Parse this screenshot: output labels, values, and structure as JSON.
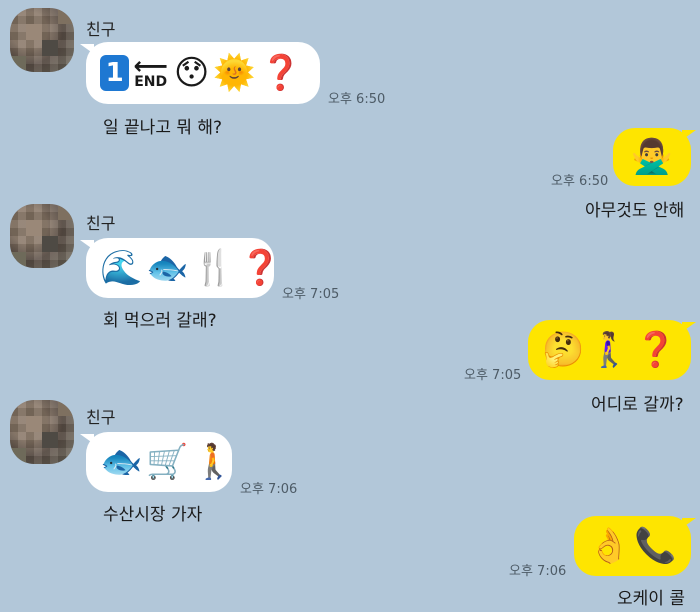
{
  "contact_name": "친구",
  "messages": [
    {
      "sender": "friend",
      "emoji": [
        "keycap-1",
        "end-arrow",
        "😯",
        "🌞",
        "❓"
      ],
      "text": "일 끝나고 뭐 해?",
      "time": "오후 6:50"
    },
    {
      "sender": "me",
      "emoji": [
        "🙅‍♂️"
      ],
      "text": "아무것도 안해",
      "time": "오후 6:50"
    },
    {
      "sender": "friend",
      "emoji": [
        "🌊",
        "🐟",
        "🍴",
        "❓"
      ],
      "text": "회 먹으러 갈래?",
      "time": "오후 7:05"
    },
    {
      "sender": "me",
      "emoji": [
        "🤔",
        "🚶‍♀️",
        "❓"
      ],
      "text": "어디로 갈까?",
      "time": "오후 7:05"
    },
    {
      "sender": "friend",
      "emoji": [
        "🐟",
        "🛒",
        "🚶"
      ],
      "text": "수산시장 가자",
      "time": "오후 7:06"
    },
    {
      "sender": "me",
      "emoji": [
        "👌",
        "📞"
      ],
      "text": "오케이 콜",
      "time": "오후 7:06"
    }
  ],
  "icons": {
    "keycap": "1",
    "end_label": "END",
    "end_arrow": "⟵"
  },
  "colors": {
    "background": "#b2c7d9",
    "friend_bubble": "#ffffff",
    "my_bubble": "#fee500"
  }
}
